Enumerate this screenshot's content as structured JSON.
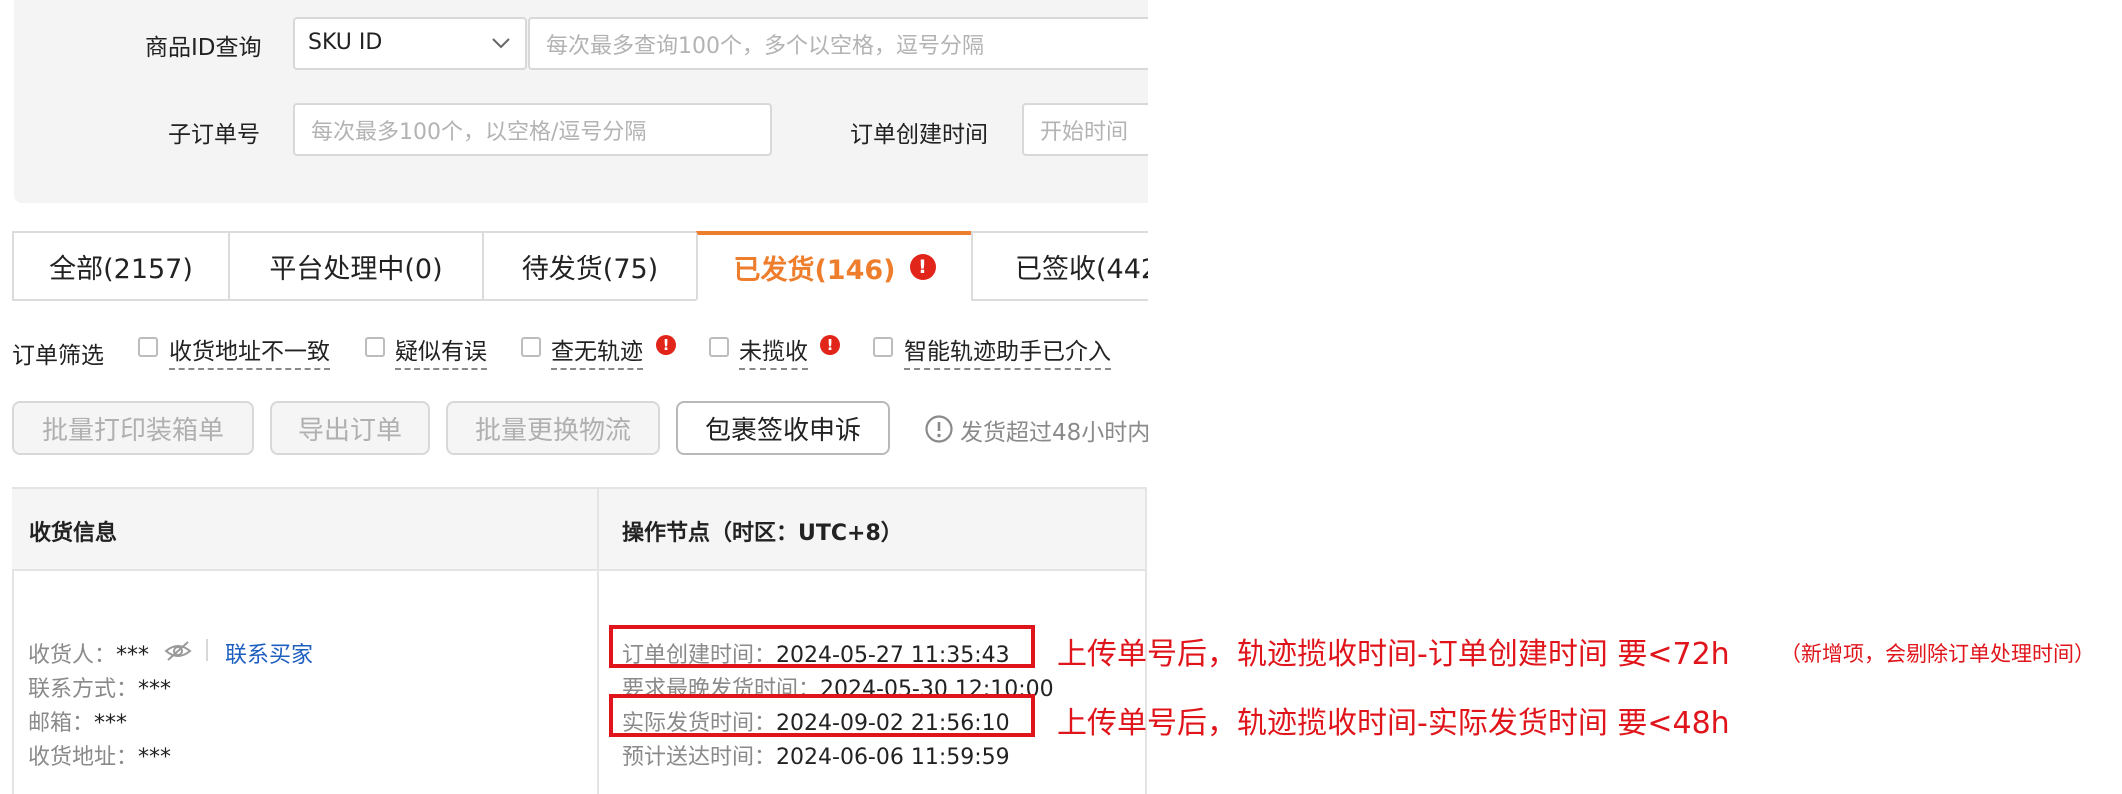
{
  "filters": {
    "product_id_label": "商品ID查询",
    "sku_select_value": "SKU ID",
    "product_id_placeholder": "每次最多查询100个，多个以空格，逗号分隔",
    "sub_order_label": "子订单号",
    "sub_order_placeholder": "每次最多100个，以空格/逗号分隔",
    "create_time_label": "订单创建时间",
    "start_time_placeholder": "开始时间"
  },
  "tabs": [
    {
      "label": "全部(2157)"
    },
    {
      "label": "平台处理中(0)"
    },
    {
      "label": "待发货(75)"
    },
    {
      "label": "已发货(146)",
      "active": true
    },
    {
      "label": "已签收(442"
    }
  ],
  "order_filter": {
    "label": "订单筛选",
    "options": [
      "收货地址不一致",
      "疑似有误",
      "查无轨迹",
      "未揽收",
      "智能轨迹助手已介入"
    ]
  },
  "actions": {
    "print_boxes": "批量打印装箱单",
    "export_orders": "导出订单",
    "change_logistics": "批量更换物流",
    "package_appeal": "包裹签收申诉",
    "tip": "发货超过48小时内"
  },
  "table": {
    "col_shipping": "收货信息",
    "col_nodes": "操作节点（时区：UTC+8）"
  },
  "row": {
    "recipient_label": "收货人：",
    "recipient_value": "***",
    "contact_seller_link": "联系买家",
    "phone_label": "联系方式：",
    "phone_value": "***",
    "email_label": "邮箱：",
    "email_value": "***",
    "address_label": "收货地址：",
    "address_value": "***",
    "created_label": "订单创建时间：",
    "created_value": "2024-05-27 11:35:43",
    "latest_ship_label": "要求最晚发货时间：",
    "latest_ship_value": "2024-05-30 12:10:00",
    "actual_ship_label": "实际发货时间：",
    "actual_ship_value": "2024-09-02 21:56:10",
    "eta_label": "预计送达时间：",
    "eta_value": "2024-06-06 11:59:59"
  },
  "annotations": {
    "note1": "上传单号后，轨迹揽收时间-订单创建时间 要<72h",
    "note1_small": "（新增项，会剔除订单处理时间）",
    "note2": "上传单号后，轨迹揽收时间-实际发货时间 要<48h"
  },
  "colors": {
    "accent": "#ee7d2c",
    "alert": "#e1251b",
    "annotation_red": "#e0151b",
    "link": "#1d5fbf"
  },
  "icons": {
    "select_caret": "chevron-down-icon",
    "alert": "exclamation-circle-icon",
    "tip": "info-circle-icon",
    "mask": "eye-off-icon"
  }
}
